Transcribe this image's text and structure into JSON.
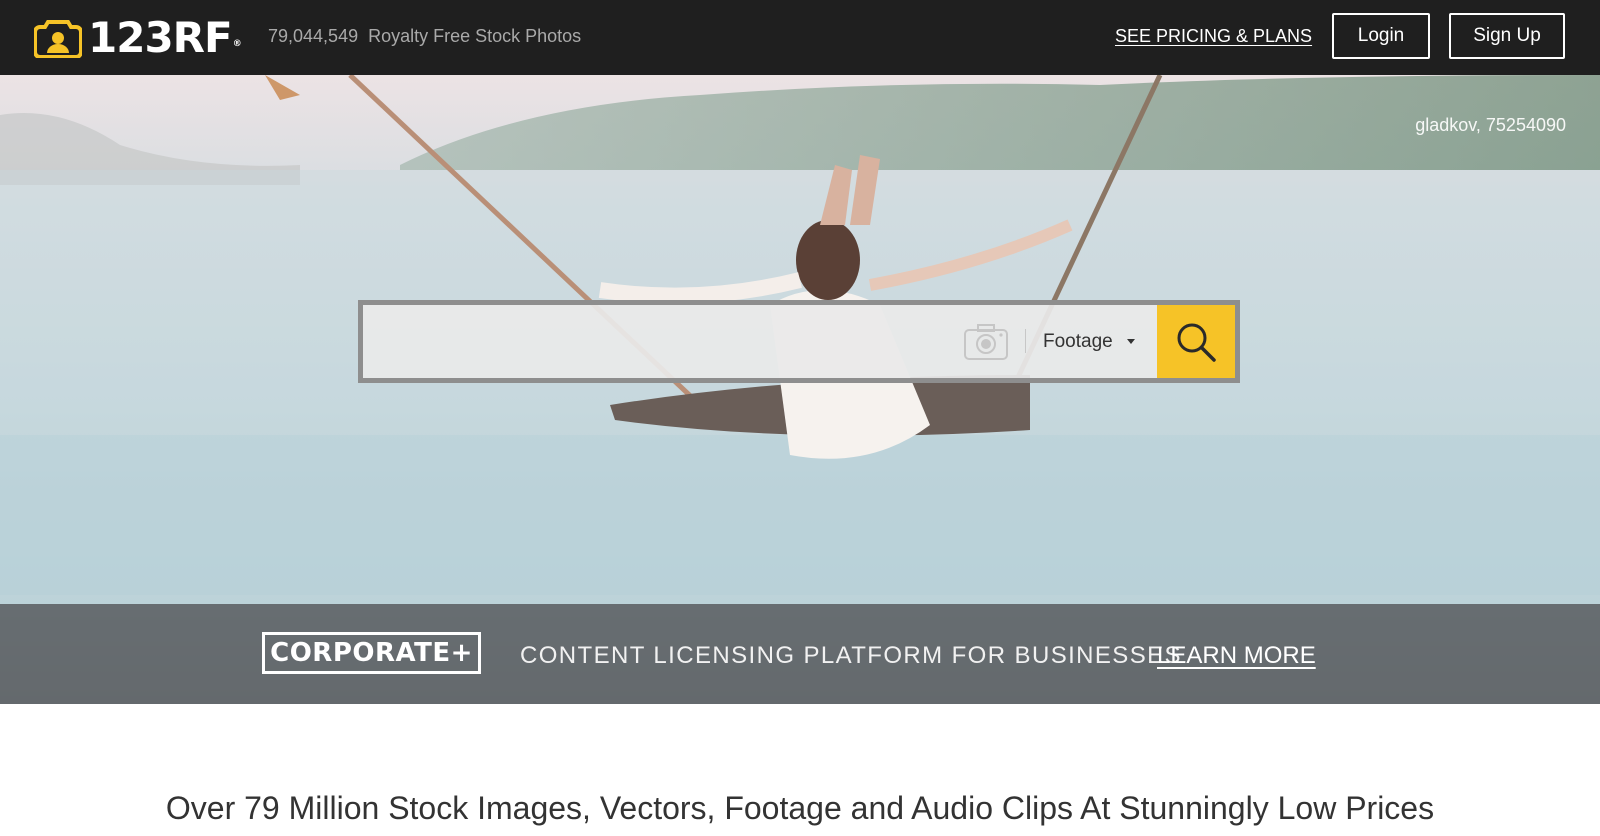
{
  "header": {
    "logo_text": "123RF",
    "logo_reg": "®",
    "stat_count": "79,044,549",
    "stat_label": "Royalty Free Stock Photos",
    "pricing_link": "SEE PRICING & PLANS",
    "login_label": "Login",
    "signup_label": "Sign Up"
  },
  "hero": {
    "photo_credit": "gladkov, 75254090",
    "search": {
      "placeholder": "",
      "value": "",
      "type_selected": "Footage"
    }
  },
  "corporate": {
    "badge": "CORPORATE+",
    "tagline": "CONTENT LICENSING PLATFORM FOR BUSINESSES",
    "learn_more": "LEARN MORE"
  },
  "main": {
    "headline": "Over 79 Million Stock Images, Vectors, Footage and Audio Clips At Stunningly Low Prices"
  },
  "colors": {
    "topbar": "#1f1f1f",
    "accent": "#f6c327",
    "band": "#585c5f"
  },
  "icons": {
    "logo": "camera-logo-icon",
    "image_search": "camera-icon",
    "search": "search-icon",
    "dropdown": "caret-down-icon"
  }
}
